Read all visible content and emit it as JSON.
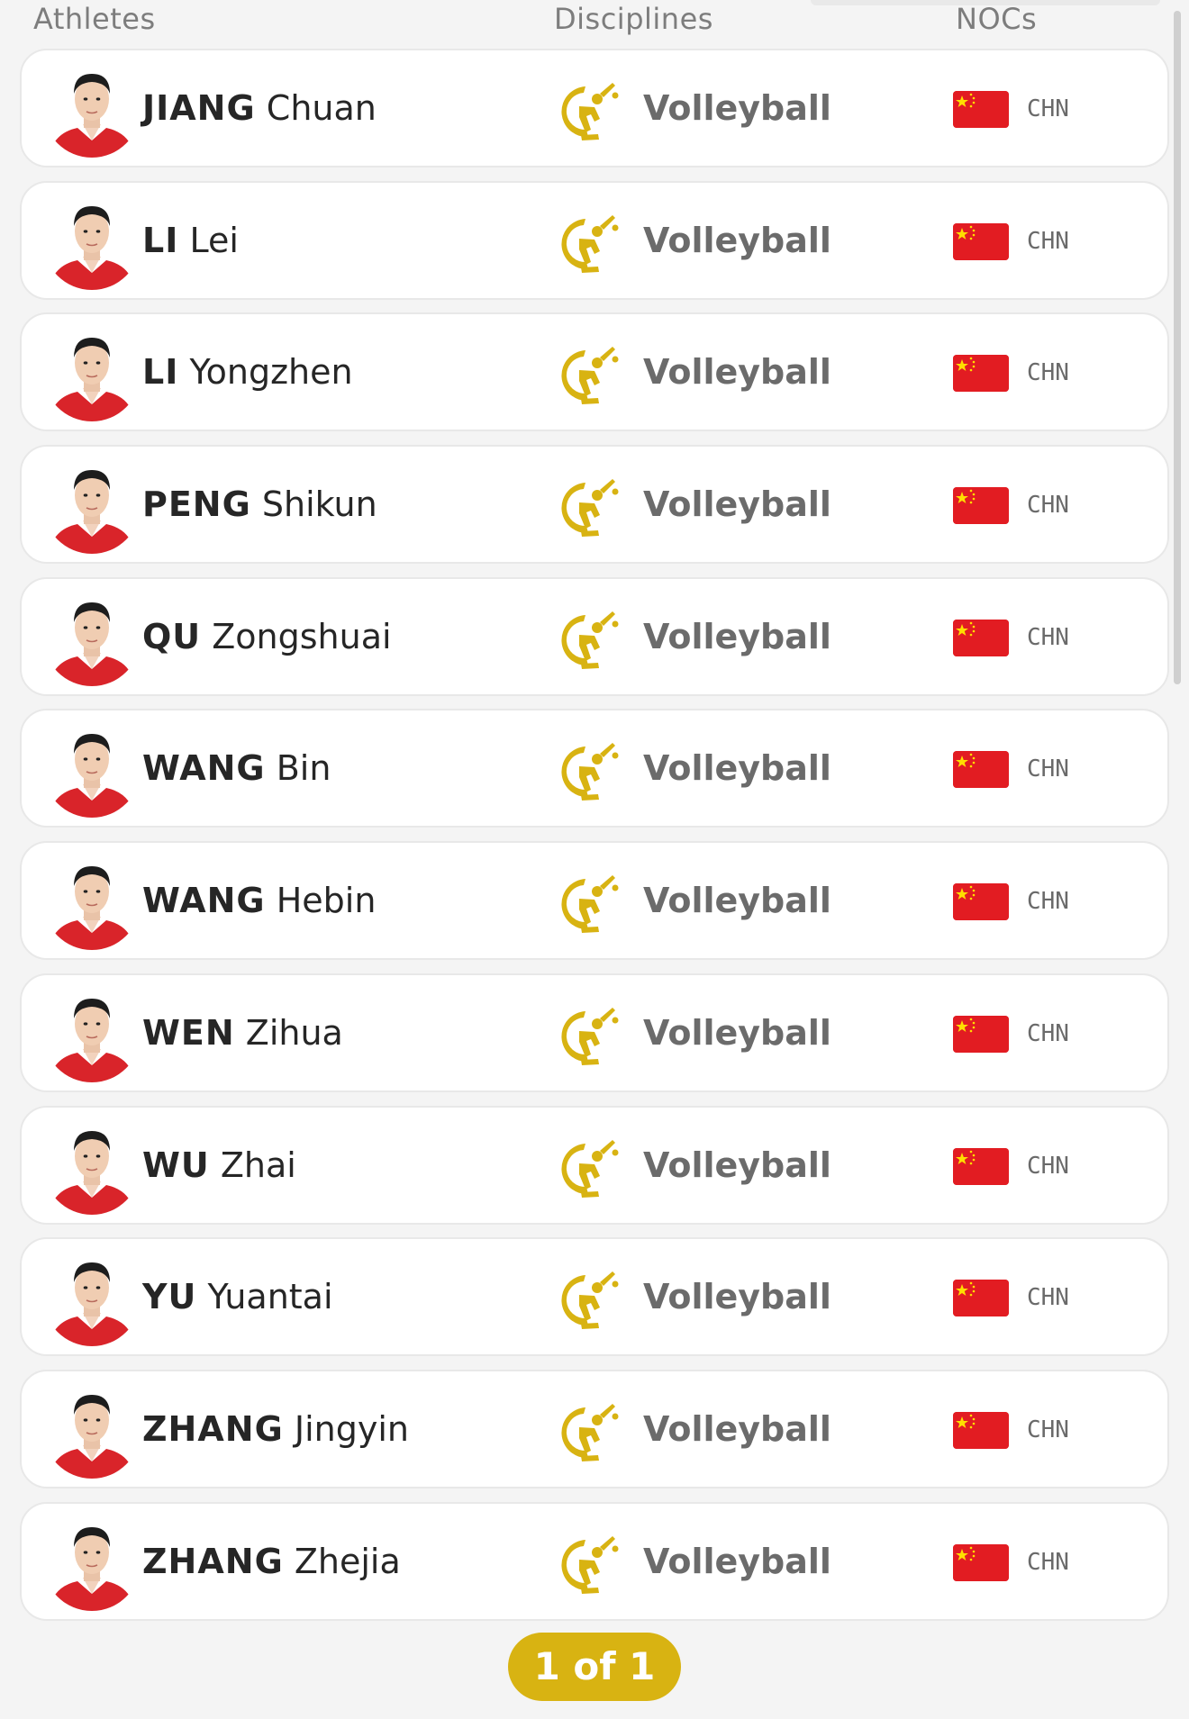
{
  "header": {
    "athletes": "Athletes",
    "disciplines": "Disciplines",
    "nocs": "NOCs"
  },
  "rows": [
    {
      "family": "JIANG",
      "given": "Chuan",
      "discipline": "Volleyball",
      "noc": "CHN"
    },
    {
      "family": "LI",
      "given": "Lei",
      "discipline": "Volleyball",
      "noc": "CHN"
    },
    {
      "family": "LI",
      "given": "Yongzhen",
      "discipline": "Volleyball",
      "noc": "CHN"
    },
    {
      "family": "PENG",
      "given": "Shikun",
      "discipline": "Volleyball",
      "noc": "CHN"
    },
    {
      "family": "QU",
      "given": "Zongshuai",
      "discipline": "Volleyball",
      "noc": "CHN"
    },
    {
      "family": "WANG",
      "given": "Bin",
      "discipline": "Volleyball",
      "noc": "CHN"
    },
    {
      "family": "WANG",
      "given": "Hebin",
      "discipline": "Volleyball",
      "noc": "CHN"
    },
    {
      "family": "WEN",
      "given": "Zihua",
      "discipline": "Volleyball",
      "noc": "CHN"
    },
    {
      "family": "WU",
      "given": "Zhai",
      "discipline": "Volleyball",
      "noc": "CHN"
    },
    {
      "family": "YU",
      "given": "Yuantai",
      "discipline": "Volleyball",
      "noc": "CHN"
    },
    {
      "family": "ZHANG",
      "given": "Jingyin",
      "discipline": "Volleyball",
      "noc": "CHN"
    },
    {
      "family": "ZHANG",
      "given": "Zhejia",
      "discipline": "Volleyball",
      "noc": "CHN"
    }
  ],
  "pagination": {
    "label": "1 of 1"
  },
  "colors": {
    "accent_gold": "#d8b312",
    "flag_red": "#e21c22",
    "flag_star": "#ffde00",
    "jersey_red": "#d9242a"
  },
  "icons": {
    "discipline": "volleyball-pictogram-icon",
    "flag": "china-flag-icon",
    "avatar": "athlete-photo"
  }
}
